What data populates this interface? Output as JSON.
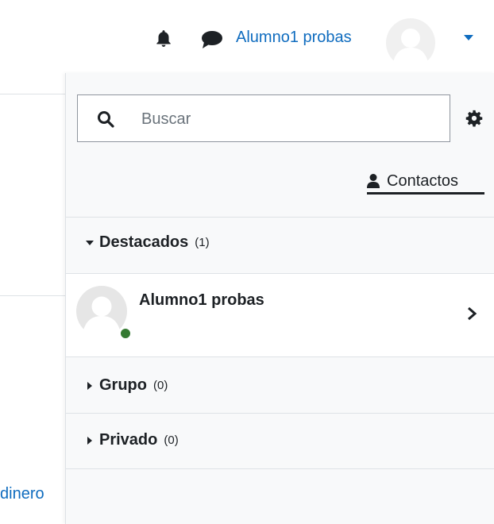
{
  "navbar": {
    "user_name": "Alumno1 probas",
    "icons": [
      "bell-icon",
      "chat-bubble-icon",
      "avatar",
      "caret-down-icon"
    ],
    "accent_color": "#0f6cbf"
  },
  "page": {
    "link_text": "dinero"
  },
  "drawer": {
    "search": {
      "placeholder": "Buscar",
      "value": ""
    },
    "contacts_label": "Contactos",
    "sections": [
      {
        "title": "Destacados",
        "count": "(1)",
        "expanded": true
      },
      {
        "title": "Grupo",
        "count": "(0)",
        "expanded": false
      },
      {
        "title": "Privado",
        "count": "(0)",
        "expanded": false
      }
    ],
    "starred_contacts": [
      {
        "name": "Alumno1 probas",
        "status": "online",
        "status_color": "#357a32"
      }
    ]
  }
}
